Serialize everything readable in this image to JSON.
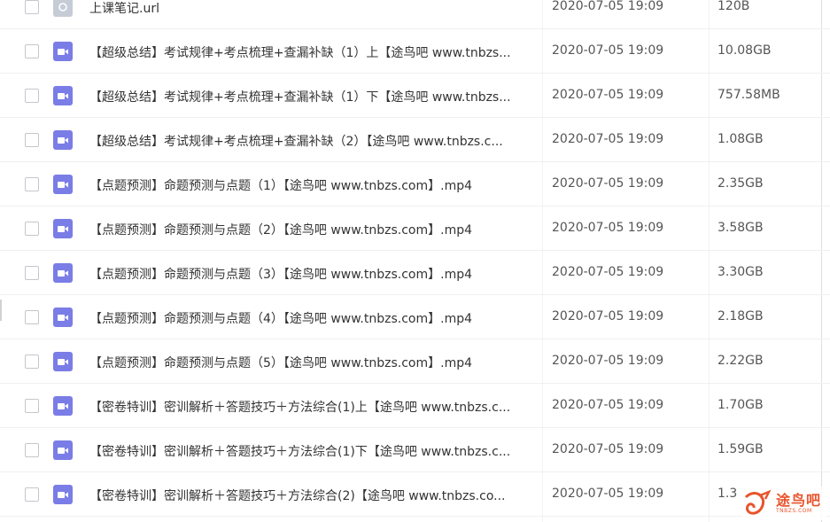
{
  "files": [
    {
      "name": "上课笔记.url",
      "date": "2020-07-05 19:09",
      "size": "120B",
      "type": "url"
    },
    {
      "name": "【超级总结】考试规律+考点梳理+查漏补缺（1）上【途鸟吧 www.tnbzs...",
      "date": "2020-07-05 19:09",
      "size": "10.08GB",
      "type": "video"
    },
    {
      "name": "【超级总结】考试规律+考点梳理+查漏补缺（1）下【途鸟吧 www.tnbzs...",
      "date": "2020-07-05 19:09",
      "size": "757.58MB",
      "type": "video"
    },
    {
      "name": "【超级总结】考试规律+考点梳理+查漏补缺（2）【途鸟吧 www.tnbzs.c...",
      "date": "2020-07-05 19:09",
      "size": "1.08GB",
      "type": "video"
    },
    {
      "name": "【点题预测】命题预测与点题（1）【途鸟吧 www.tnbzs.com】.mp4",
      "date": "2020-07-05 19:09",
      "size": "2.35GB",
      "type": "video"
    },
    {
      "name": "【点题预测】命题预测与点题（2）【途鸟吧 www.tnbzs.com】.mp4",
      "date": "2020-07-05 19:09",
      "size": "3.58GB",
      "type": "video"
    },
    {
      "name": "【点题预测】命题预测与点题（3）【途鸟吧 www.tnbzs.com】.mp4",
      "date": "2020-07-05 19:09",
      "size": "3.30GB",
      "type": "video"
    },
    {
      "name": "【点题预测】命题预测与点题（4）【途鸟吧 www.tnbzs.com】.mp4",
      "date": "2020-07-05 19:09",
      "size": "2.18GB",
      "type": "video"
    },
    {
      "name": "【点题预测】命题预测与点题（5）【途鸟吧 www.tnbzs.com】.mp4",
      "date": "2020-07-05 19:09",
      "size": "2.22GB",
      "type": "video"
    },
    {
      "name": "【密卷特训】密训解析＋答题技巧＋方法综合(1)上【途鸟吧 www.tnbzs.c...",
      "date": "2020-07-05 19:09",
      "size": "1.70GB",
      "type": "video"
    },
    {
      "name": "【密卷特训】密训解析＋答题技巧＋方法综合(1)下【途鸟吧 www.tnbzs.c...",
      "date": "2020-07-05 19:09",
      "size": "1.59GB",
      "type": "video"
    },
    {
      "name": "【密卷特训】密训解析＋答题技巧＋方法综合(2)【途鸟吧 www.tnbzs.co...",
      "date": "2020-07-05 19:09",
      "size": "1.3",
      "type": "video"
    }
  ],
  "watermark": {
    "title": "途鸟吧",
    "subtitle": "TNBZS.COM"
  },
  "colors": {
    "video_icon": "#7a7de6",
    "url_icon": "#c6ccd6",
    "watermark": "#e8542c"
  }
}
